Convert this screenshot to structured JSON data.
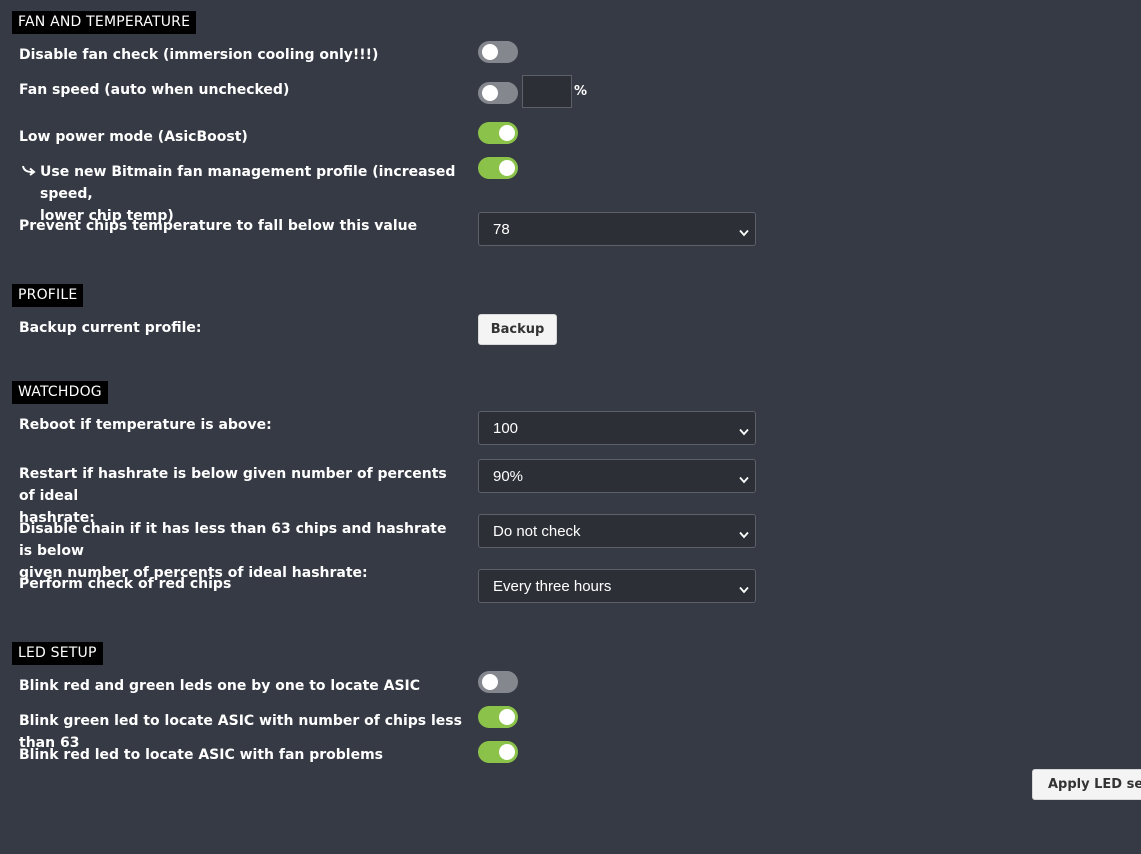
{
  "fan": {
    "title": "FAN AND TEMPERATURE",
    "disable_fan_check": {
      "label": "Disable fan check (immersion cooling only!!!)",
      "on": false
    },
    "fan_speed": {
      "label": "Fan speed (auto when unchecked)",
      "on": false,
      "value": "",
      "unit": "%"
    },
    "low_power": {
      "label": "Low power mode (AsicBoost)",
      "on": true
    },
    "bitmain_profile": {
      "label_line1": "Use new Bitmain fan management profile (increased speed,",
      "label_line2": "lower chip temp)",
      "on": true
    },
    "min_temp": {
      "label": "Prevent chips temperature to fall below this value",
      "value": "78"
    }
  },
  "profile": {
    "title": "PROFILE",
    "backup_label": "Backup current profile:",
    "backup_button": "Backup"
  },
  "watchdog": {
    "title": "WATCHDOG",
    "reboot_temp": {
      "label": "Reboot if temperature is above:",
      "value": "100"
    },
    "restart_hashrate": {
      "label_line1": "Restart if hashrate is below given number of percents of ideal",
      "label_line2": "hashrate:",
      "value": "90%"
    },
    "disable_chain": {
      "label_line1": "Disable chain if it has less than 63 chips and hashrate is below",
      "label_line2": "given number of percents of ideal hashrate:",
      "value": "Do not check"
    },
    "red_chips": {
      "label": "Perform check of red chips",
      "value": "Every three hours"
    }
  },
  "led": {
    "title": "LED SETUP",
    "blink_both": {
      "label": "Blink red and green leds one by one to locate ASIC",
      "on": false
    },
    "blink_green": {
      "label": "Blink green led to locate ASIC with number of chips less than 63",
      "on": true
    },
    "blink_red": {
      "label": "Blink red led to locate ASIC with fan problems",
      "on": true
    },
    "apply_button": "Apply LED setu"
  },
  "colors": {
    "background": "#363a44",
    "toggle_on": "#8bc34a",
    "toggle_off": "#85878e"
  },
  "icons": {
    "select_arrow": "chevron-down-icon",
    "sub_option": "curved-arrow-icon"
  }
}
